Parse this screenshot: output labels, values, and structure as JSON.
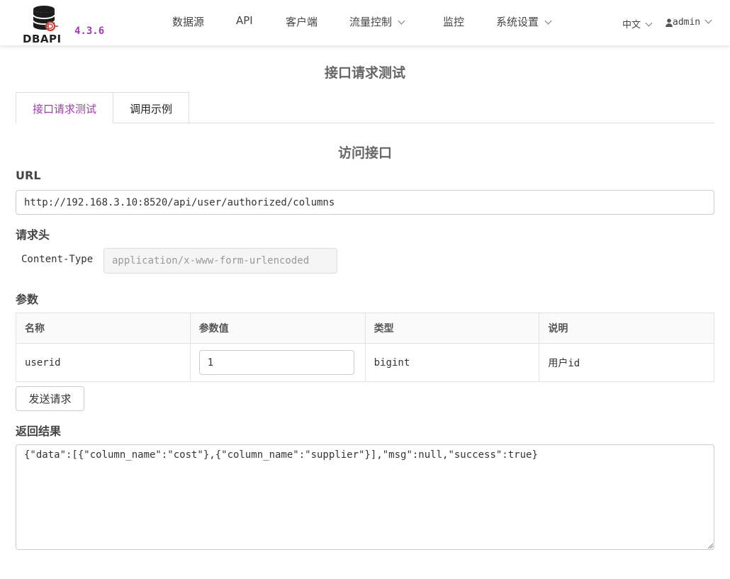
{
  "app": {
    "logo_text": "DBAPI",
    "version": "4.3.6"
  },
  "nav": {
    "items": [
      {
        "label": "数据源"
      },
      {
        "label": "API"
      },
      {
        "label": "客户端"
      },
      {
        "label": "流量控制"
      },
      {
        "label": "监控"
      },
      {
        "label": "系统设置"
      }
    ],
    "language": "中文",
    "user": "admin"
  },
  "page": {
    "title": "接口请求测试",
    "tabs": [
      {
        "label": "接口请求测试",
        "active": true
      },
      {
        "label": "调用示例",
        "active": false
      }
    ],
    "section_title": "访问接口"
  },
  "url": {
    "label": "URL",
    "value": "http://192.168.3.10:8520/api/user/authorized/columns"
  },
  "headers": {
    "label": "请求头",
    "key": "Content-Type",
    "value": "application/x-www-form-urlencoded"
  },
  "params": {
    "label": "参数",
    "columns": [
      "名称",
      "参数值",
      "类型",
      "说明"
    ],
    "rows": [
      {
        "name": "userid",
        "value": "1",
        "type": "bigint",
        "desc": "用户id"
      }
    ]
  },
  "send_button": "发送请求",
  "result": {
    "label": "返回结果",
    "value": "{\"data\":[{\"column_name\":\"cost\"},{\"column_name\":\"supplier\"}],\"msg\":null,\"success\":true}"
  },
  "colors": {
    "accent": "#a33ab2",
    "text": "#333333",
    "border": "#cccccc"
  }
}
